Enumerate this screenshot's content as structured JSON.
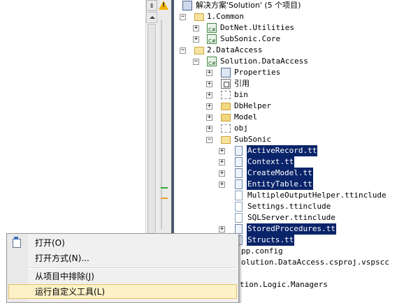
{
  "scrollbar": {
    "split_icon": "⇕"
  },
  "solution_tree": {
    "root": "解决方案'Solution' (5 个项目)",
    "nodes": [
      {
        "label": "1.Common",
        "expander": "−",
        "icon": "folder-open"
      },
      {
        "label": "DotNet.Utilities",
        "expander": "+",
        "icon": "csharp-project"
      },
      {
        "label": "SubSonic.Core",
        "expander": "+",
        "icon": "csharp-project"
      },
      {
        "label": "2.DataAccess",
        "expander": "−",
        "icon": "folder-open"
      },
      {
        "label": "Solution.DataAccess",
        "expander": "−",
        "icon": "csharp-project"
      },
      {
        "label": "Properties",
        "expander": "+",
        "icon": "properties"
      },
      {
        "label": "引用",
        "expander": "+",
        "icon": "references"
      },
      {
        "label": "bin",
        "expander": "+",
        "icon": "folder-hidden"
      },
      {
        "label": "DbHelper",
        "expander": "+",
        "icon": "folder"
      },
      {
        "label": "Model",
        "expander": "+",
        "icon": "folder"
      },
      {
        "label": "obj",
        "expander": "+",
        "icon": "folder-hidden"
      },
      {
        "label": "SubSonic",
        "expander": "−",
        "icon": "folder-open"
      },
      {
        "label": "ActiveRecord.tt",
        "expander": "+",
        "icon": "tt-file",
        "selected": true
      },
      {
        "label": "Context.tt",
        "expander": "+",
        "icon": "tt-file",
        "selected": true
      },
      {
        "label": "CreateModel.tt",
        "expander": "+",
        "icon": "tt-file",
        "selected": true
      },
      {
        "label": "EntityTable.tt",
        "expander": "+",
        "icon": "tt-file",
        "selected": true
      },
      {
        "label": "MultipleOutputHelper.ttinclude",
        "icon": "file"
      },
      {
        "label": "Settings.ttinclude",
        "icon": "file"
      },
      {
        "label": "SQLServer.ttinclude",
        "icon": "file"
      },
      {
        "label": "StoredProcedures.tt",
        "expander": "+",
        "icon": "tt-file",
        "selected": true
      },
      {
        "label": "Structs.tt",
        "icon": "tt-file",
        "selected": true
      },
      {
        "label": "pp.config"
      },
      {
        "label": "olution.DataAccess.csproj.vspscc"
      },
      {
        "label": "tion.Logic.Managers"
      }
    ]
  },
  "context_menu": {
    "items": [
      {
        "label": "打开(O)",
        "icon": "open-file-icon"
      },
      {
        "label": "打开方式(N)..."
      },
      {
        "label": "从项目中排除(J)"
      },
      {
        "label": "运行自定义工具(L)",
        "highlighted": true
      }
    ]
  },
  "colors": {
    "selection_bg": "#0a246a",
    "menu_highlight": "#fdf1c8",
    "pane_border": "#4d5a6e"
  }
}
